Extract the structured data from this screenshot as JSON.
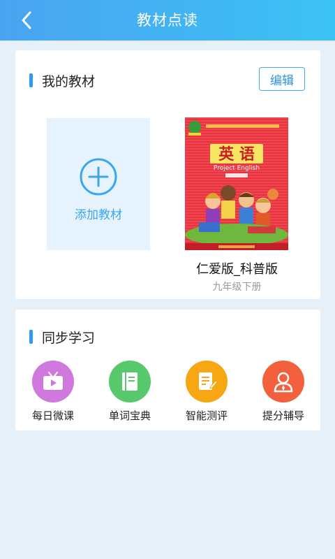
{
  "header": {
    "title": "教材点读",
    "back_icon": "chevron-left-icon"
  },
  "my_textbooks": {
    "section_title": "我的教材",
    "edit_label": "编辑",
    "add_label": "添加教材",
    "add_icon": "plus-circle-icon",
    "book": {
      "cover_title": "英 语",
      "cover_subtitle": "Project English",
      "name": "仁爱版_科普版",
      "grade": "九年级下册"
    }
  },
  "sync_study": {
    "section_title": "同步学习",
    "features": [
      {
        "label": "每日微课",
        "icon": "video-icon",
        "color": "#cf78dd"
      },
      {
        "label": "单词宝典",
        "icon": "book-icon",
        "color": "#58c86c"
      },
      {
        "label": "智能测评",
        "icon": "test-edit-icon",
        "color": "#f7a614"
      },
      {
        "label": "提分辅导",
        "icon": "tutor-icon",
        "color": "#f2603e"
      }
    ]
  }
}
